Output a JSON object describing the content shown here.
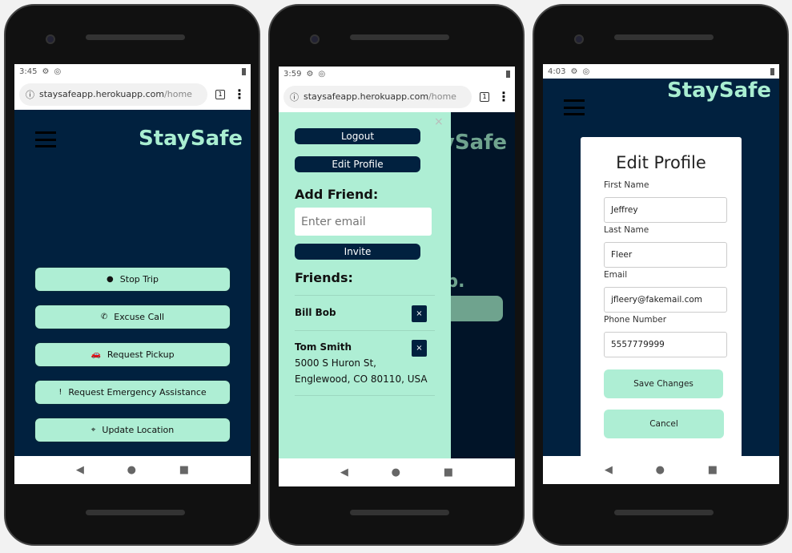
{
  "browser": {
    "domain": "staysafeapp.herokuapp.com",
    "path": "/home",
    "tab_count": "1"
  },
  "app": {
    "logo": "StaySafe",
    "accent": "#aeeed4",
    "bg": "#01213f"
  },
  "phone1": {
    "time": "3:45",
    "actions": [
      {
        "icon": "stop-icon",
        "glyph": "●",
        "label": "Stop Trip"
      },
      {
        "icon": "phone-icon",
        "glyph": "✆",
        "label": "Excuse Call"
      },
      {
        "icon": "car-icon",
        "glyph": "🚗",
        "label": "Request Pickup"
      },
      {
        "icon": "alert-icon",
        "glyph": "!",
        "label": "Request Emergency Assistance"
      },
      {
        "icon": "map-icon",
        "glyph": "⌖",
        "label": "Update Location"
      }
    ]
  },
  "phone2": {
    "time": "3:59",
    "close": "×",
    "logout": "Logout",
    "edit_profile": "Edit Profile",
    "add_friend": "Add Friend:",
    "email_placeholder": "Enter email",
    "invite": "Invite",
    "friends_title": "Friends:",
    "behind_text": "rip.",
    "friends": [
      {
        "name": "Bill Bob",
        "address": ""
      },
      {
        "name": "Tom Smith",
        "address": "5000 S Huron St, Englewood, CO 80110, USA"
      }
    ],
    "remove": "×"
  },
  "phone3": {
    "time": "4:03",
    "title": "Edit Profile",
    "fields": [
      {
        "label": "First Name",
        "value": "Jeffrey"
      },
      {
        "label": "Last Name",
        "value": "Fleer"
      },
      {
        "label": "Email",
        "value": "jfleery@fakemail.com"
      },
      {
        "label": "Phone Number",
        "value": "5557779999"
      }
    ],
    "save": "Save Changes",
    "cancel": "Cancel"
  },
  "nav": {
    "back": "◀",
    "home": "●",
    "recents": "■"
  }
}
